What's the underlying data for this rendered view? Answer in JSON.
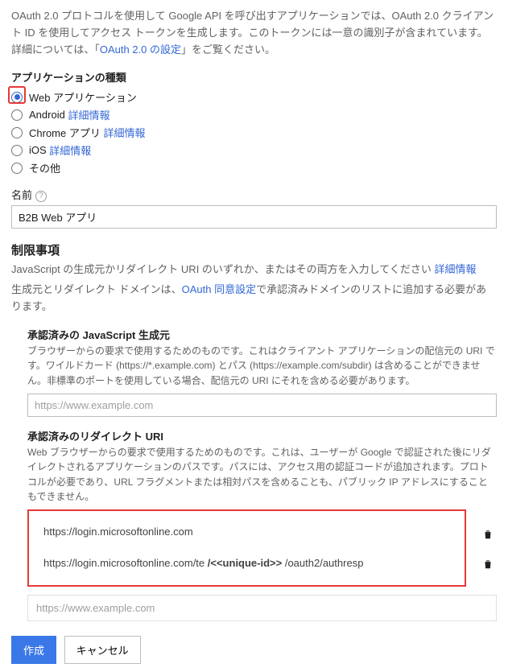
{
  "intro": {
    "text_a": "OAuth 2.0 プロトコルを使用して Google API を呼び出すアプリケーションでは、OAuth 2.0 クライアント ID を使用してアクセス トークンを生成します。このトークンには一意の識別子が含まれています。詳細については、「",
    "link": "OAuth 2.0 の設定",
    "text_b": "」をご覧ください。"
  },
  "app_type": {
    "title": "アプリケーションの種類",
    "options": {
      "web": "Web アプリケーション",
      "android": "Android",
      "android_more": "詳細情報",
      "chrome": "Chrome アプリ",
      "chrome_more": "詳細情報",
      "ios": "iOS",
      "ios_more": "詳細情報",
      "other": "その他"
    }
  },
  "name": {
    "label": "名前",
    "value": "B2B Web アプリ"
  },
  "restrictions": {
    "title": "制限事項",
    "desc_a": "JavaScript の生成元かリダイレクト URI のいずれか、またはその両方を入力してください ",
    "desc_link": "詳細情報",
    "desc_b_a": "生成元とリダイレクト ドメインは、",
    "desc_b_link": "OAuth 同意設定",
    "desc_b_b": "で承認済みドメインのリストに追加する必要があります。"
  },
  "js_origins": {
    "title": "承認済みの JavaScript 生成元",
    "desc": "ブラウザーからの要求で使用するためのものです。これはクライアント アプリケーションの配信元の URI です。ワイルドカード (https://*.example.com) とパス (https://example.com/subdir) は含めることができません。非標準のポートを使用している場合、配信元の URI にそれを含める必要があります。",
    "placeholder": "https://www.example.com"
  },
  "redirect": {
    "title": "承認済みのリダイレクト URI",
    "desc": "Web ブラウザーからの要求で使用するためのものです。これは、ユーザーが Google で認証された後にリダイレクトされるアプリケーションのパスです。パスには、アクセス用の認証コードが追加されます。プロトコルが必要であり、URL フラグメントまたは相対パスを含めることも、パブリック IP アドレスにすることもできません。",
    "uri1": "https://login.microsoftonline.com",
    "uri2_a": "https://login.microsoftonline.com/te ",
    "uri2_b": "/<<unique-id>> ",
    "uri2_c": "/oauth2/authresp",
    "placeholder": "https://www.example.com"
  },
  "buttons": {
    "create": "作成",
    "cancel": "キャンセル"
  }
}
